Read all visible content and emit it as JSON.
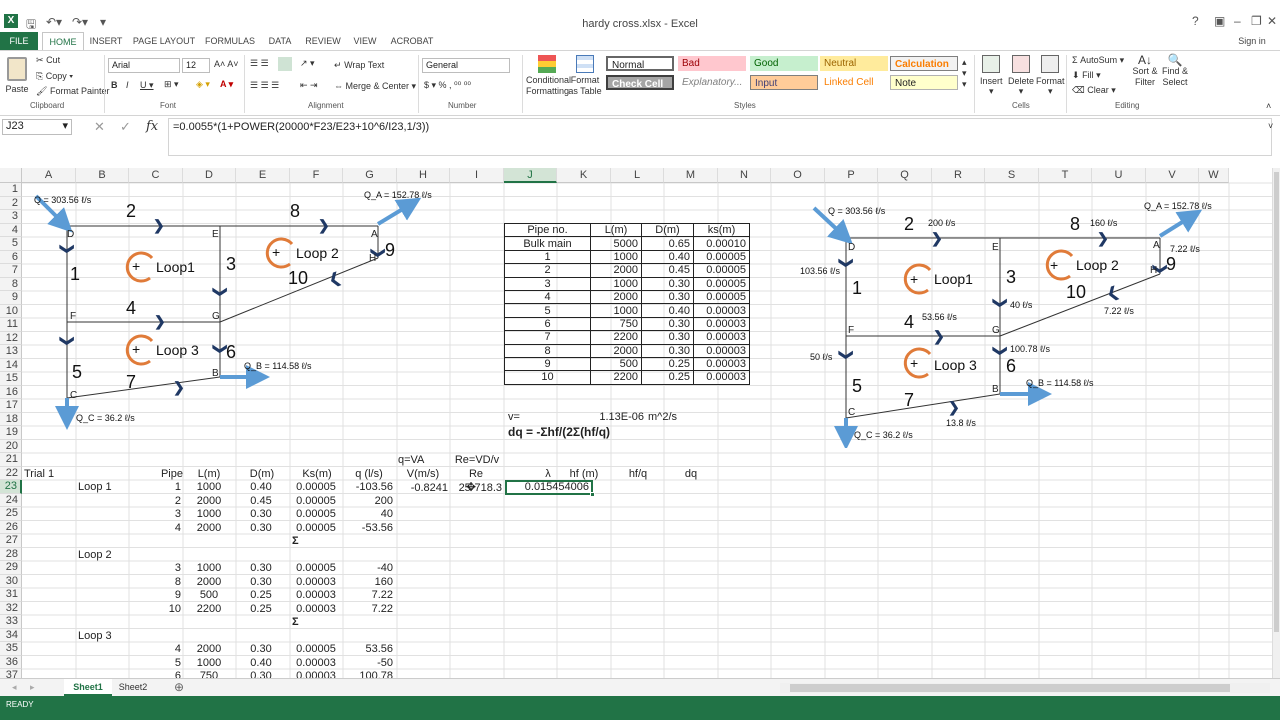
{
  "window": {
    "title": "hardy cross.xlsx - Excel",
    "signin": "Sign in"
  },
  "tabs": [
    "FILE",
    "HOME",
    "INSERT",
    "PAGE LAYOUT",
    "FORMULAS",
    "DATA",
    "REVIEW",
    "VIEW",
    "ACROBAT"
  ],
  "ribbon": {
    "clipboard": {
      "paste": "Paste",
      "cut": "Cut",
      "copy": "Copy",
      "format_painter": "Format Painter",
      "label": "Clipboard"
    },
    "font": {
      "name": "Arial",
      "size": "12",
      "label": "Font"
    },
    "alignment": {
      "wrap": "Wrap Text",
      "merge": "Merge & Center",
      "label": "Alignment"
    },
    "number": {
      "format": "General",
      "label": "Number"
    },
    "styles": {
      "cond": "Conditional Formatting",
      "fmt_table": "Format as Table",
      "normal": "Normal",
      "bad": "Bad",
      "good": "Good",
      "neutral": "Neutral",
      "calculation": "Calculation",
      "check": "Check Cell",
      "explanatory": "Explanatory...",
      "input": "Input",
      "linked": "Linked Cell",
      "note": "Note",
      "label": "Styles"
    },
    "cells": {
      "insert": "Insert",
      "delete": "Delete",
      "format": "Format",
      "label": "Cells"
    },
    "editing": {
      "autosum": "AutoSum",
      "fill": "Fill",
      "clear": "Clear",
      "sort": "Sort & Filter",
      "find": "Find & Select",
      "label": "Editing"
    }
  },
  "formula_bar": {
    "name_box": "J23",
    "formula": "=0.0055*(1+POWER(20000*F23/E23+10^6/I23,1/3))"
  },
  "columns": [
    "A",
    "B",
    "C",
    "D",
    "E",
    "F",
    "G",
    "H",
    "I",
    "J",
    "K",
    "L",
    "M",
    "N",
    "O",
    "P",
    "Q",
    "R",
    "S",
    "T",
    "U",
    "V",
    "W"
  ],
  "rows": [
    "1",
    "2",
    "3",
    "4",
    "5",
    "6",
    "7",
    "8",
    "9",
    "10",
    "11",
    "12",
    "13",
    "14",
    "15",
    "16",
    "17",
    "18",
    "19",
    "20",
    "21",
    "22",
    "23",
    "24",
    "25",
    "26",
    "27",
    "28",
    "29",
    "30",
    "31",
    "32",
    "33",
    "34",
    "35",
    "36",
    "37"
  ],
  "pipe_table": {
    "headers": [
      "Pipe no.",
      "L(m)",
      "D(m)",
      "ks(m)"
    ],
    "rows": [
      [
        "Bulk main",
        "5000",
        "0.65",
        "0.00010"
      ],
      [
        "1",
        "1000",
        "0.40",
        "0.00005"
      ],
      [
        "2",
        "2000",
        "0.45",
        "0.00005"
      ],
      [
        "3",
        "1000",
        "0.30",
        "0.00005"
      ],
      [
        "4",
        "2000",
        "0.30",
        "0.00005"
      ],
      [
        "5",
        "1000",
        "0.40",
        "0.00003"
      ],
      [
        "6",
        "750",
        "0.30",
        "0.00003"
      ],
      [
        "7",
        "2200",
        "0.30",
        "0.00003"
      ],
      [
        "8",
        "2000",
        "0.30",
        "0.00003"
      ],
      [
        "9",
        "500",
        "0.25",
        "0.00003"
      ],
      [
        "10",
        "2200",
        "0.25",
        "0.00003"
      ]
    ]
  },
  "viscosity": {
    "label": "v=",
    "value": "1.13E-06",
    "unit": "m^2/s"
  },
  "dq_formula": "dq = -Σhf/(2Σ(hf/q)",
  "headers_top": {
    "va": "q=VA",
    "re": "Re=VD/v"
  },
  "headers": {
    "trial": "Trial 1",
    "pipe": "Pipe",
    "l": "L(m)",
    "d": "D(m)",
    "ks": "Ks(m)",
    "q": "q (l/s)",
    "v": "V(m/s)",
    "re": "Re",
    "lambda": "λ",
    "hf": "hf (m)",
    "hfq": "hf/q",
    "dq": "dq"
  },
  "loops": [
    {
      "name": "Loop 1",
      "rows": [
        [
          "1",
          "1000",
          "0.40",
          "0.00005",
          "-103.56"
        ],
        [
          "2",
          "2000",
          "0.45",
          "0.00005",
          "200"
        ],
        [
          "3",
          "1000",
          "0.30",
          "0.00005",
          "40"
        ],
        [
          "4",
          "2000",
          "0.30",
          "0.00005",
          "-53.56"
        ]
      ]
    },
    {
      "name": "Loop 2",
      "rows": [
        [
          "3",
          "1000",
          "0.30",
          "0.00005",
          "-40"
        ],
        [
          "8",
          "2000",
          "0.30",
          "0.00003",
          "160"
        ],
        [
          "9",
          "500",
          "0.25",
          "0.00003",
          "7.22"
        ],
        [
          "10",
          "2200",
          "0.25",
          "0.00003",
          "7.22"
        ]
      ]
    },
    {
      "name": "Loop 3",
      "rows": [
        [
          "4",
          "2000",
          "0.30",
          "0.00005",
          "53.56"
        ],
        [
          "5",
          "1000",
          "0.40",
          "0.00003",
          "-50"
        ],
        [
          "6",
          "750",
          "0.30",
          "0.00003",
          "100.78"
        ]
      ]
    }
  ],
  "row23": {
    "v": "-0.8241",
    "re": "25·718.3",
    "lambda": "0.015454006"
  },
  "sigma": "Σ",
  "diagram1": {
    "q_in": "Q = 303.56 ℓ/s",
    "qa": "Q_A = 152.78 ℓ/s",
    "qb": "Q_B = 114.58 ℓ/s",
    "qc": "Q_C = 36.2 ℓ/s",
    "loop1": "Loop1",
    "loop2": "Loop 2",
    "loop3": "Loop 3",
    "plus": "+"
  },
  "diagram2": {
    "q_in": "Q = 303.56 ℓ/s",
    "qa": "Q_A = 152.78 ℓ/s",
    "qb": "Q_B = 114.58 ℓ/s",
    "qc": "Q_C = 36.2 ℓ/s",
    "f2": "200 ℓ/s",
    "f8": "160 ℓ/s",
    "f1": "103.56 ℓ/s",
    "f3": "40 ℓ/s",
    "f4": "53.56 ℓ/s",
    "f5": "50 ℓ/s",
    "f6": "100.78 ℓ/s",
    "f7": "13.8 ℓ/s",
    "f9": "7.22 ℓ/s",
    "f10": "7.22 ℓ/s",
    "loop1": "Loop1",
    "loop2": "Loop 2",
    "loop3": "Loop 3",
    "plus": "+"
  },
  "sheets": [
    "Sheet1",
    "Sheet2"
  ],
  "status": "READY"
}
